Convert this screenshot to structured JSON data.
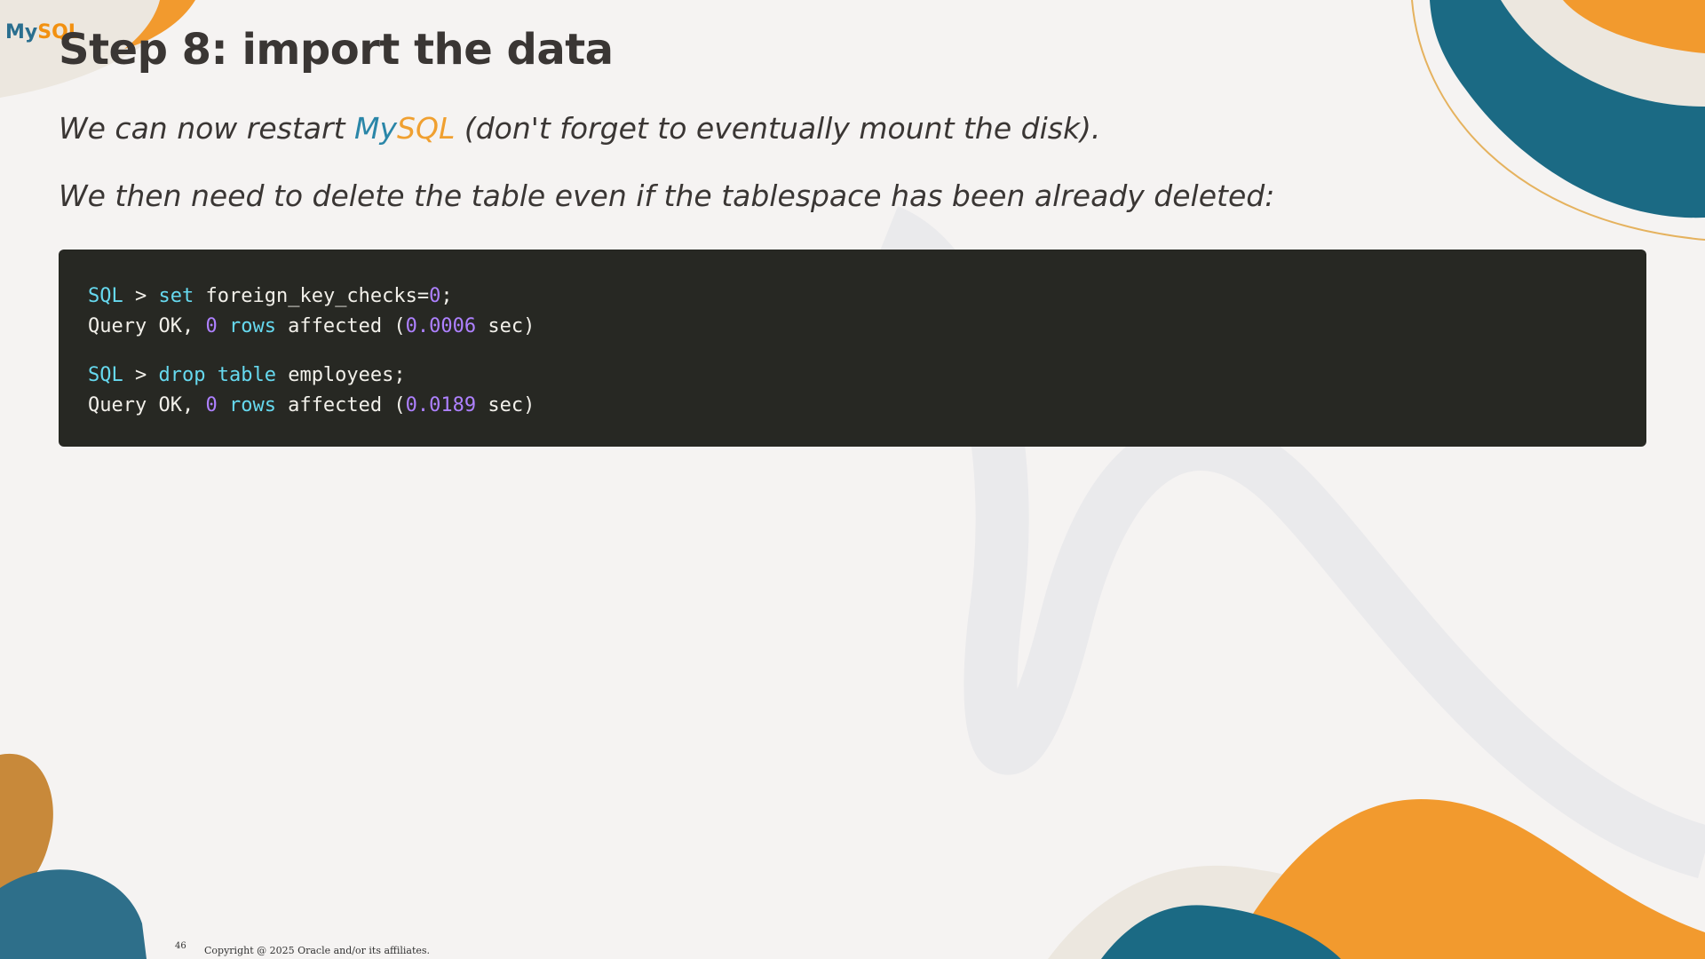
{
  "logo": {
    "my": "My",
    "sql": "SQL"
  },
  "slide": {
    "title": "Step 8: import the data",
    "para1": {
      "before": "We can now restart ",
      "my": "My",
      "sql": "SQL",
      "after": " (don't forget to eventually mount the disk)."
    },
    "para2": "We then need to delete the table even if the tablespace has been already deleted:"
  },
  "code": {
    "block1": {
      "prompt": "SQL",
      "arrow": " > ",
      "keyword": "set",
      "statement": " foreign_key_checks=",
      "value": "0",
      "end": ";",
      "result_prefix": "Query OK, ",
      "rows_count": "0",
      "rows_word": "rows",
      "result_mid": " affected (",
      "time": "0.0006",
      "result_suffix": " sec)"
    },
    "block2": {
      "prompt": "SQL",
      "arrow": " > ",
      "keyword": "drop table",
      "statement": " employees;",
      "result_prefix": "Query OK, ",
      "rows_count": "0",
      "rows_word": "rows",
      "result_mid": " affected (",
      "time": "0.0189",
      "result_suffix": " sec)"
    }
  },
  "footer": {
    "page_number": "46",
    "copyright": "Copyright @ 2025 Oracle and/or its affiliates."
  },
  "colors": {
    "background": "#f5f3f2",
    "teal": "#1b6a84",
    "orange": "#f29a2e",
    "code_bg": "#272823"
  }
}
